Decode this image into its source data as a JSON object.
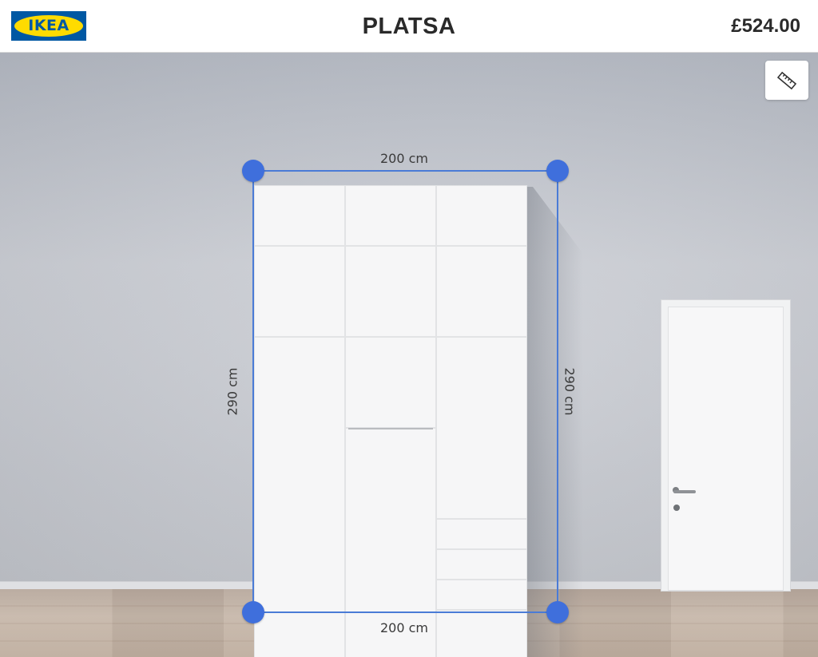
{
  "header": {
    "logo_text": "IKEA",
    "product_name": "PLATSA",
    "price": "£524.00"
  },
  "toolbar": {
    "measure_icon": "ruler-icon"
  },
  "dimensions": {
    "top_width": "200 cm",
    "bottom_width": "200 cm",
    "left_height": "290 cm",
    "right_height": "290 cm"
  },
  "colors": {
    "ikea_blue": "#0058a3",
    "ikea_yellow": "#ffdb00",
    "measure_blue": "#3f6fdc"
  }
}
